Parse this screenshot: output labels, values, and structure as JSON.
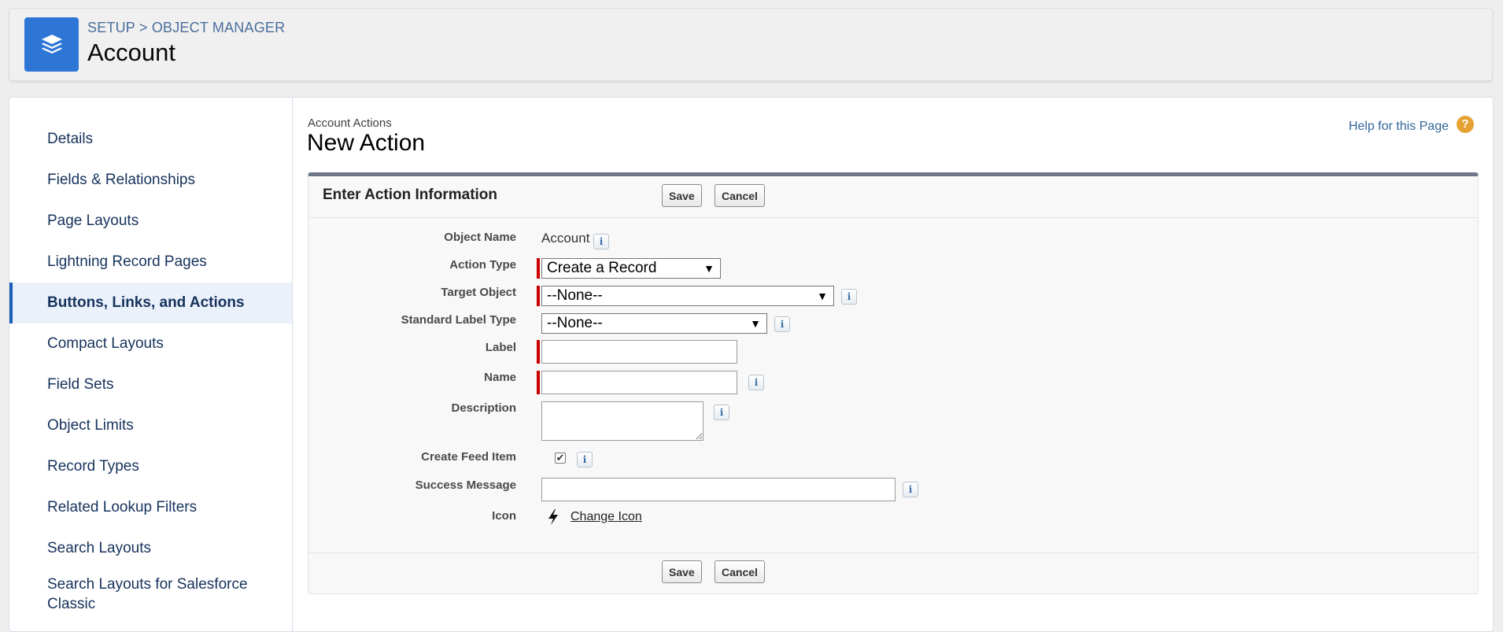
{
  "header": {
    "breadcrumb_setup": "SETUP",
    "breadcrumb_sep": ">",
    "breadcrumb_object_manager": "OBJECT MANAGER",
    "title": "Account",
    "icon": "layers-icon",
    "icon_color": "#2e76d6"
  },
  "sidebar": {
    "items": [
      {
        "label": "Details"
      },
      {
        "label": "Fields & Relationships"
      },
      {
        "label": "Page Layouts"
      },
      {
        "label": "Lightning Record Pages"
      },
      {
        "label": "Buttons, Links, and Actions",
        "active": true
      },
      {
        "label": "Compact Layouts"
      },
      {
        "label": "Field Sets"
      },
      {
        "label": "Object Limits"
      },
      {
        "label": "Record Types"
      },
      {
        "label": "Related Lookup Filters"
      },
      {
        "label": "Search Layouts"
      },
      {
        "label": "Search Layouts for Salesforce Classic"
      }
    ]
  },
  "content": {
    "subtitle": "Account Actions",
    "title": "New Action",
    "help_link": "Help for this Page",
    "help_icon": "?"
  },
  "form": {
    "section_title": "Enter Action Information",
    "save_label": "Save",
    "cancel_label": "Cancel",
    "info_glyph": "i",
    "fields": {
      "object_name": {
        "label": "Object Name",
        "value": "Account"
      },
      "action_type": {
        "label": "Action Type",
        "value": "Create a Record"
      },
      "target_object": {
        "label": "Target Object",
        "value": "--None--"
      },
      "standard_label_type": {
        "label": "Standard Label Type",
        "value": "--None--"
      },
      "label": {
        "label": "Label",
        "value": ""
      },
      "name": {
        "label": "Name",
        "value": ""
      },
      "description": {
        "label": "Description",
        "value": ""
      },
      "create_feed_item": {
        "label": "Create Feed Item",
        "checked": true
      },
      "success_message": {
        "label": "Success Message",
        "value": ""
      },
      "icon": {
        "label": "Icon",
        "link": "Change Icon",
        "icon_name": "lightning-bolt-icon"
      }
    }
  },
  "colors": {
    "required_bar": "#cc0000",
    "active_nav_border": "#1b5fb8",
    "help_icon_bg": "#e5a234"
  }
}
